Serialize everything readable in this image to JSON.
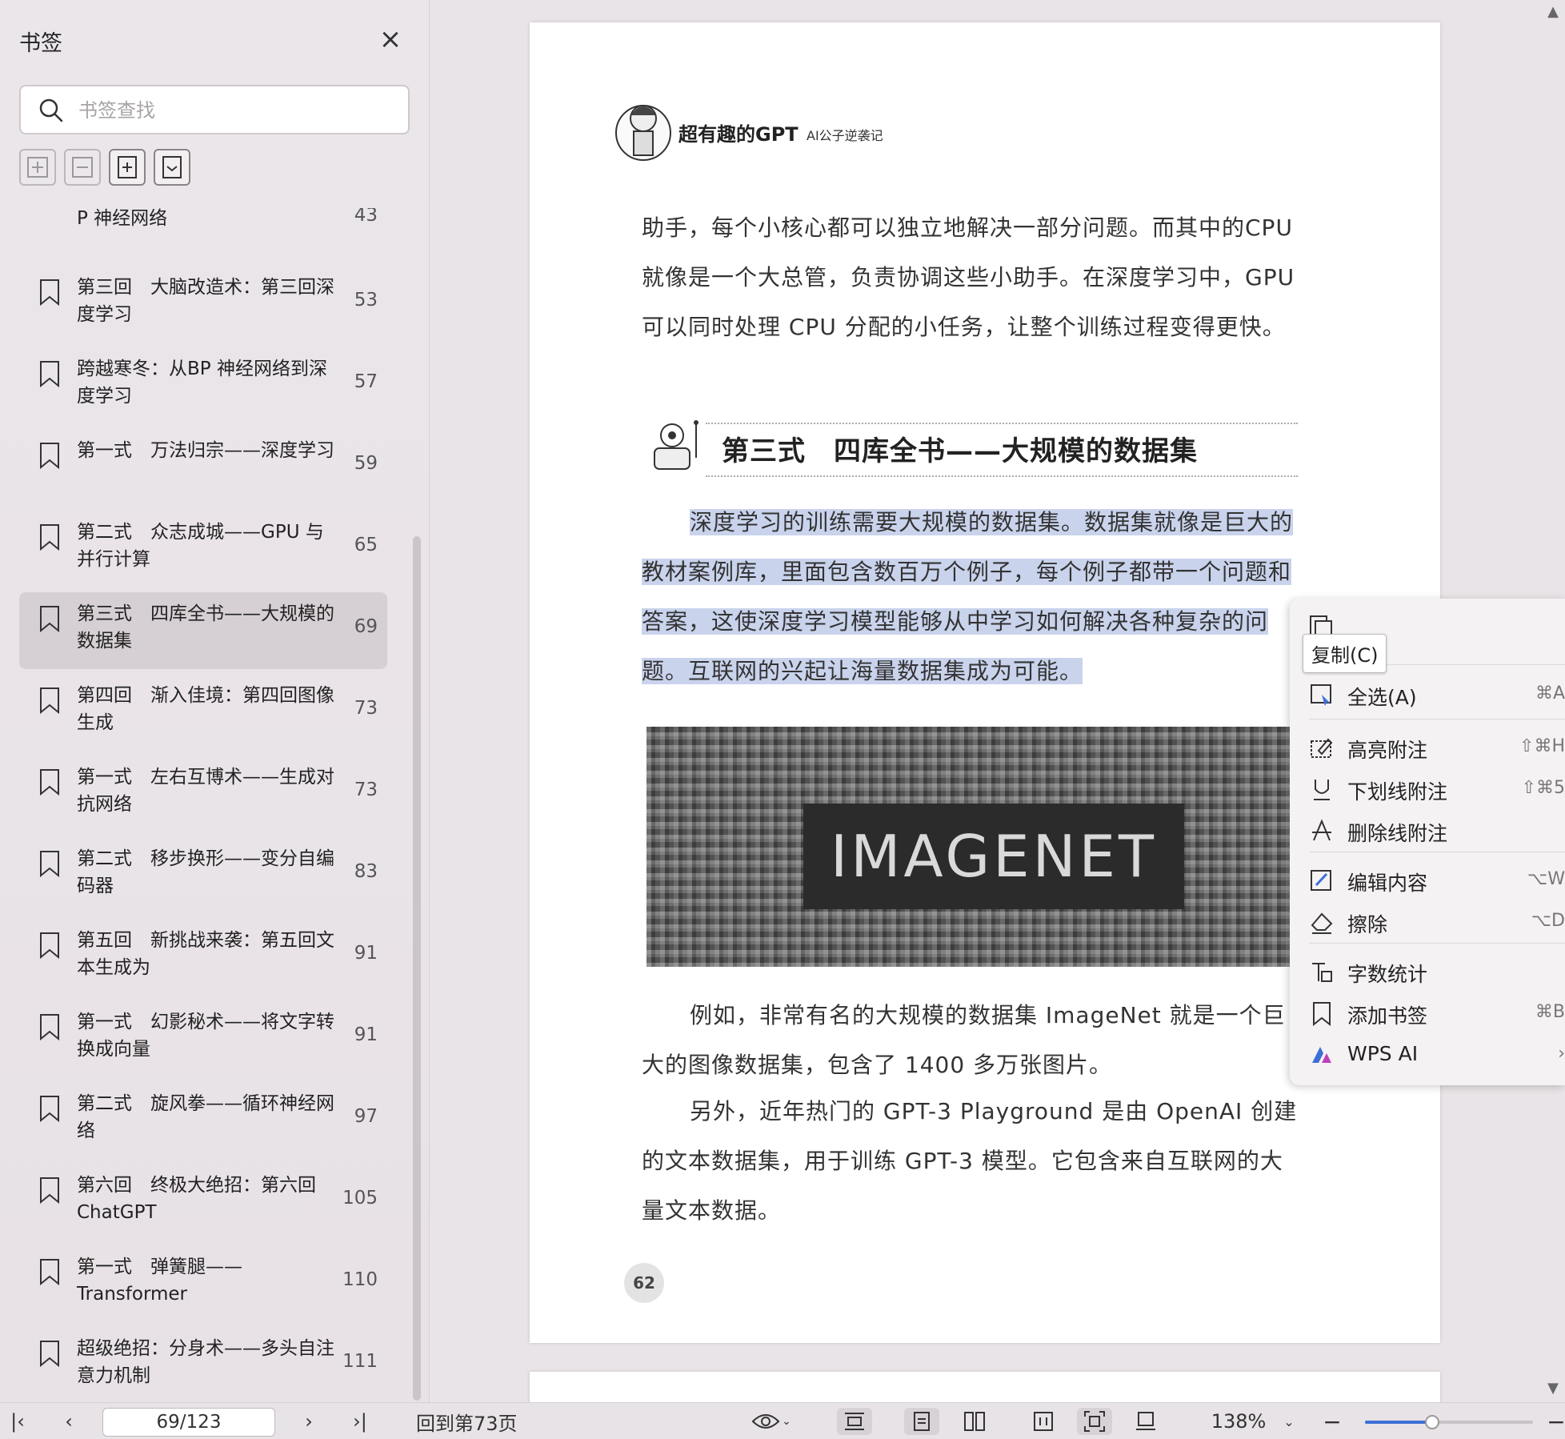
{
  "sidebar": {
    "title": "书签",
    "search_placeholder": "书签查找",
    "tools": [
      "expand-all-icon",
      "collapse-all-icon",
      "add-bookmark-icon",
      "bookmark-icon"
    ],
    "partial_item": {
      "label": "P 神经网络",
      "page": "43"
    },
    "items": [
      {
        "label": "第三回　大脑改造术：第三回深度学习",
        "page": "53",
        "selected": false
      },
      {
        "label": "跨越寒冬：从BP 神经网络到深度学习",
        "page": "57",
        "selected": false
      },
      {
        "label": "第一式　万法归宗——深度学习",
        "page": "59",
        "selected": false
      },
      {
        "label": "第二式　众志成城——GPU 与并行计算",
        "page": "65",
        "selected": false
      },
      {
        "label": "第三式　四库全书——大规模的数据集",
        "page": "69",
        "selected": true
      },
      {
        "label": "第四回　渐入佳境：第四回图像生成",
        "page": "73",
        "selected": false
      },
      {
        "label": "第一式　左右互博术——生成对抗网络",
        "page": "73",
        "selected": false
      },
      {
        "label": "第二式　移步换形——变分自编码器",
        "page": "83",
        "selected": false
      },
      {
        "label": "第五回　新挑战来袭：第五回文本生成为",
        "page": "91",
        "selected": false
      },
      {
        "label": "第一式　幻影秘术——将文字转换成向量",
        "page": "91",
        "selected": false
      },
      {
        "label": "第二式　旋风拳——循环神经网络",
        "page": "97",
        "selected": false
      },
      {
        "label": "第六回　终极大绝招：第六回ChatGPT",
        "page": "105",
        "selected": false
      },
      {
        "label": "第一式　弹簧腿——Transformer",
        "page": "110",
        "selected": false
      },
      {
        "label": "超级绝招：分身术——多头自注意力机制",
        "page": "111",
        "selected": false
      }
    ]
  },
  "document": {
    "book_title": "超有趣的GPT",
    "book_subtitle": "AI公子逆袭记",
    "para1": "助手，每个小核心都可以独立地解决一部分问题。而其中的CPU 就像是一个大总管，负责协调这些小助手。在深度学习中，GPU 可以同时处理 CPU 分配的小任务，让整个训练过程变得更快。",
    "section_title": "第三式　四库全书——大规模的数据集",
    "para2": "深度学习的训练需要大规模的数据集。数据集就像是巨大的教材案例库，里面包含数百万个例子，每个例子都带一个问题和答案，这使深度学习模型能够从中学习如何解决各种复杂的问题。互联网的兴起让海量数据集成为可能。",
    "image_text": "IMAGENET",
    "para3": "例如，非常有名的大规模的数据集 ImageNet 就是一个巨大的图像数据集，包含了 1400 多万张图片。",
    "para4": "另外，近年热门的 GPT-3 Playground 是由 OpenAI 创建的文本数据集，用于训练 GPT-3 模型。它包含来自互联网的大量文本数据。",
    "page_number": "62"
  },
  "context_menu": {
    "tooltip": "复制(C)",
    "items": [
      {
        "label": "全选(A)",
        "shortcut": "⌘A",
        "icon": "select-all-icon"
      },
      {
        "label": "高亮附注",
        "shortcut": "⇧⌘H",
        "icon": "highlight-icon"
      },
      {
        "label": "下划线附注",
        "shortcut": "⇧⌘5",
        "icon": "underline-icon"
      },
      {
        "label": "删除线附注",
        "shortcut": "",
        "icon": "strikethrough-icon"
      },
      {
        "label": "编辑内容",
        "shortcut": "⌥W",
        "icon": "edit-icon"
      },
      {
        "label": "擦除",
        "shortcut": "⌥D",
        "icon": "eraser-icon"
      },
      {
        "label": "字数统计",
        "shortcut": "",
        "icon": "word-count-icon"
      },
      {
        "label": "添加书签",
        "shortcut": "⌘B",
        "icon": "bookmark-icon"
      },
      {
        "label": "WPS AI",
        "shortcut": "›",
        "icon": "wps-ai-icon"
      }
    ]
  },
  "bottombar": {
    "page_value": "69/123",
    "goto_label": "回到第73页",
    "zoom": "138%",
    "zoom_fraction": 0.4
  },
  "colors": {
    "highlight": "#c9d3ec",
    "accent": "#3d6fd6",
    "selected_item": "#d6cfd3"
  }
}
